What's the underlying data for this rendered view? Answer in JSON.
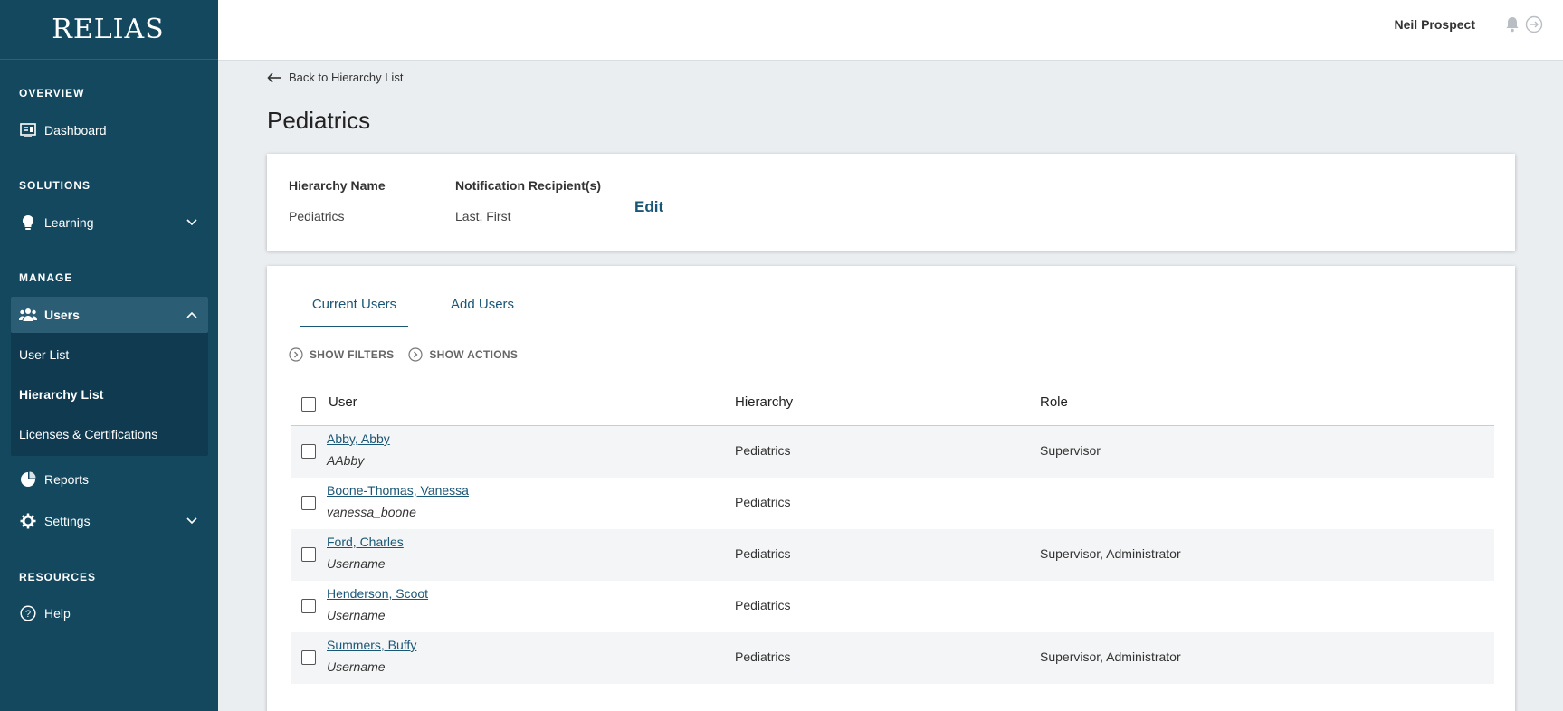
{
  "brand": {
    "logo_text": "RELIAS"
  },
  "header": {
    "user_name": "Neil Prospect",
    "icons": [
      "bell-icon",
      "logout-icon"
    ]
  },
  "sidebar": {
    "sections": {
      "overview": "OVERVIEW",
      "solutions": "SOLUTIONS",
      "manage": "MANAGE",
      "resources": "RESOURCES"
    },
    "items": {
      "dashboard": "Dashboard",
      "learning": "Learning",
      "users": "Users",
      "reports": "Reports",
      "settings": "Settings",
      "help": "Help"
    },
    "users_sub": {
      "user_list": "User List",
      "hierarchy_list": "Hierarchy List",
      "licenses": "Licenses & Certifications"
    },
    "active_sub": "Hierarchy List"
  },
  "main": {
    "back_link": "Back to Hierarchy List",
    "title": "Pediatrics",
    "info": {
      "hierarchy_name_label": "Hierarchy Name",
      "hierarchy_name_value": "Pediatrics",
      "recipients_label": "Notification Recipient(s)",
      "recipients_value": "Last, First",
      "edit_label": "Edit"
    },
    "tabs": [
      {
        "label": "Current Users",
        "active": true
      },
      {
        "label": "Add Users",
        "active": false
      }
    ],
    "toggles": {
      "filters": "SHOW FILTERS",
      "actions": "SHOW ACTIONS"
    },
    "table": {
      "columns": [
        "User",
        "Hierarchy",
        "Role"
      ],
      "rows": [
        {
          "name": "Abby, Abby",
          "login": "AAbby",
          "hierarchy": "Pediatrics",
          "role": "Supervisor"
        },
        {
          "name": "Boone-Thomas, Vanessa",
          "login": "vanessa_boone",
          "hierarchy": "Pediatrics",
          "role": ""
        },
        {
          "name": "Ford, Charles",
          "login": "Username",
          "hierarchy": "Pediatrics",
          "role": "Supervisor, Administrator"
        },
        {
          "name": "Henderson, Scoot",
          "login": "Username",
          "hierarchy": "Pediatrics",
          "role": ""
        },
        {
          "name": "Summers, Buffy",
          "login": "Username",
          "hierarchy": "Pediatrics",
          "role": "Supervisor, Administrator"
        }
      ]
    }
  },
  "colors": {
    "sidebar_bg": "#13485f",
    "sidebar_active": "#2b5d74",
    "link": "#1a5675",
    "page_bg": "#ebeef1"
  }
}
